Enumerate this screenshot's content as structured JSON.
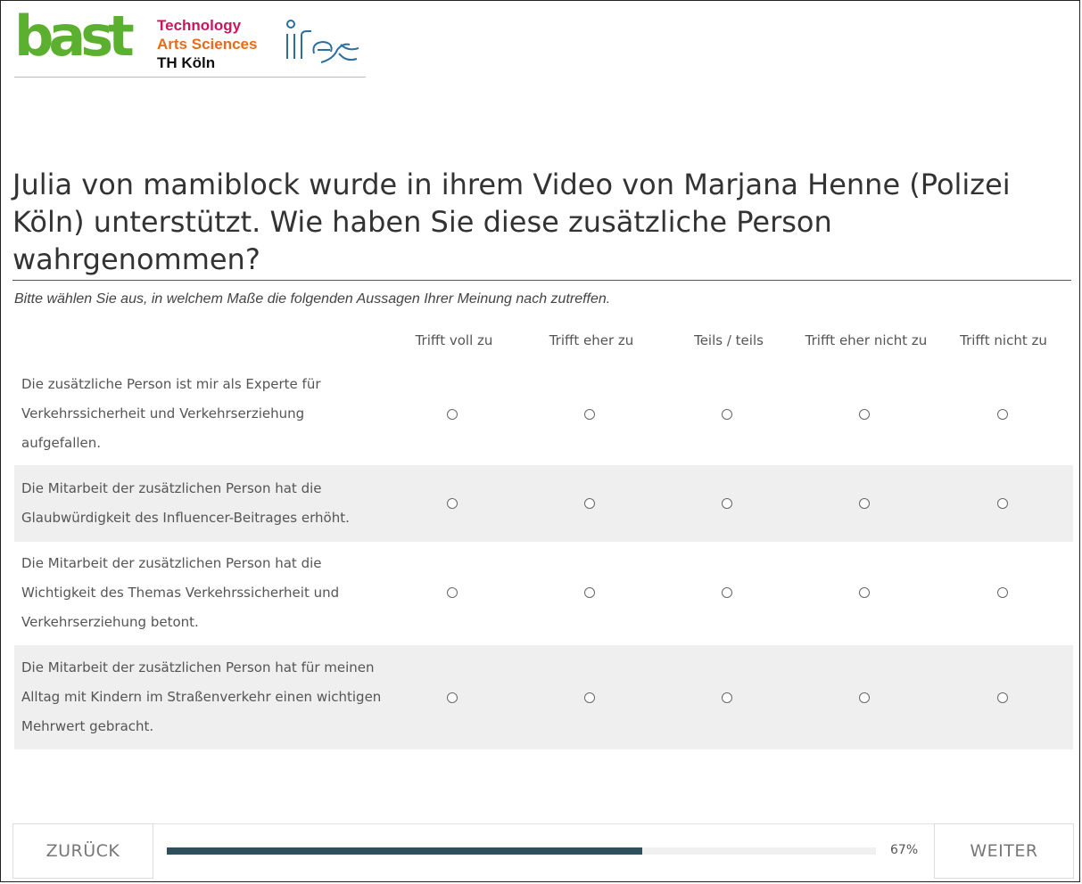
{
  "logos": {
    "bast": "bast",
    "th_koeln": [
      "Technology",
      "Arts Sciences",
      "TH Köln"
    ],
    "ifes": "ifes"
  },
  "question": {
    "title": "Julia von mamiblock wurde in ihrem Video von Marjana Henne (Polizei Köln) unterstützt. Wie haben Sie diese zusätzliche Person wahrgenommen?",
    "instruction": "Bitte wählen Sie aus, in welchem Maße die folgenden Aussagen Ihrer Meinung nach zutreffen."
  },
  "scale": [
    "Trifft voll zu",
    "Trifft eher zu",
    "Teils / teils",
    "Trifft eher nicht zu",
    "Trifft nicht zu"
  ],
  "statements": [
    "Die zusätzliche Person ist mir als Experte für Verkehrssicherheit und Verkehrserziehung aufgefallen.",
    "Die Mitarbeit der zusätzlichen Person hat die Glaubwürdigkeit des Influencer-Beitrages erhöht.",
    "Die Mitarbeit der zusätzlichen Person hat die Wichtigkeit des Themas Verkehrssicherheit und Verkehrserziehung betont.",
    "Die Mitarbeit der zusätzlichen Person hat für meinen Alltag mit Kindern im Straßenverkehr einen wichtigen Mehrwert gebracht."
  ],
  "navigation": {
    "back_label": "ZURÜCK",
    "next_label": "WEITER",
    "progress_text": "67%",
    "progress_fraction": 0.67
  },
  "colors": {
    "bast_green": "#5cb030",
    "th_magenta": "#c8175e",
    "th_orange": "#e96b1a",
    "progress_fill": "#2e4f5d",
    "row_shade": "#efefef"
  }
}
